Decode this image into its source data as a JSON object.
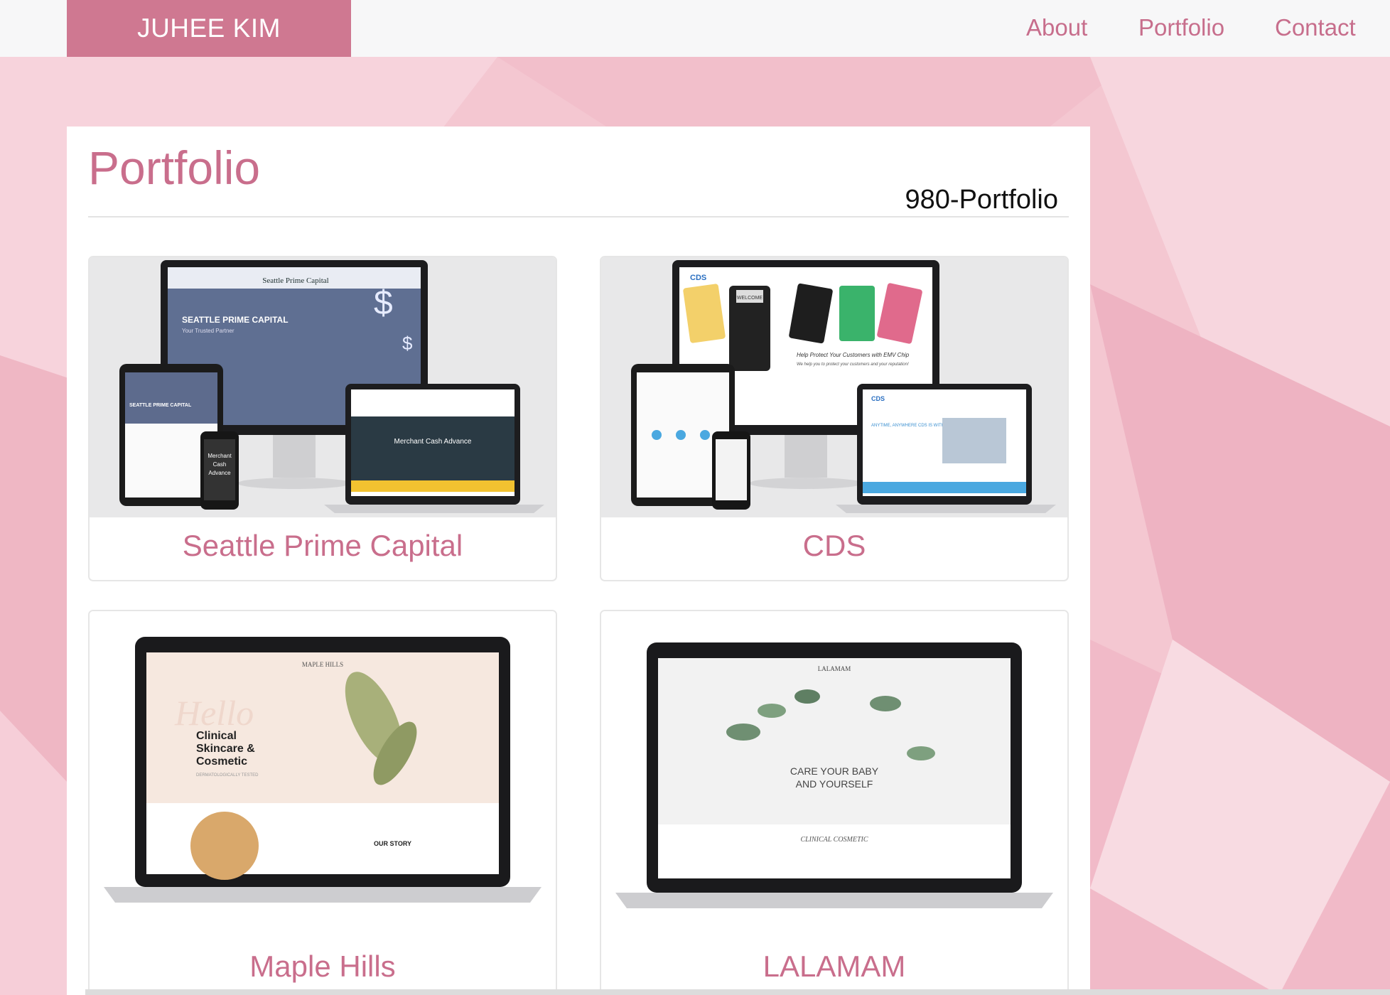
{
  "navbar": {
    "brand": "JUHEE KIM",
    "links": [
      "About",
      "Portfolio",
      "Contact"
    ]
  },
  "page": {
    "title": "Portfolio",
    "subtitle": "980-Portfolio"
  },
  "projects": [
    {
      "name": "Seattle Prime Capital",
      "screen_texts": [
        "SEATTLE PRIME CAPITAL",
        "Your Trusted Partner",
        "Merchant Cash Advance",
        "Merchant",
        "Cash",
        "Advance",
        "Seattle Prime Capital"
      ]
    },
    {
      "name": "CDS",
      "screen_texts": [
        "CDS",
        "WELCOME",
        "Help Protect Your Customers with EMV Chip",
        "We help you to protect your customers and your reputation!",
        "ANYTIME, ANYWHERE CDS IS WITH YOU"
      ]
    },
    {
      "name": "Maple Hills",
      "screen_texts": [
        "MAPLE HILLS",
        "Hello",
        "Clinical",
        "Skincare &",
        "Cosmetic",
        "DERMATOLOGICALLY TESTED",
        "OUR STORY"
      ]
    },
    {
      "name": "LALAMAM",
      "screen_texts": [
        "LALAMAM",
        "CARE YOUR BABY",
        "AND YOURSELF",
        "CLINICAL COSMETIC"
      ]
    }
  ],
  "colors": {
    "brand": "#cf7891",
    "accent": "#c96e8c",
    "background": "#f5c9d3"
  }
}
